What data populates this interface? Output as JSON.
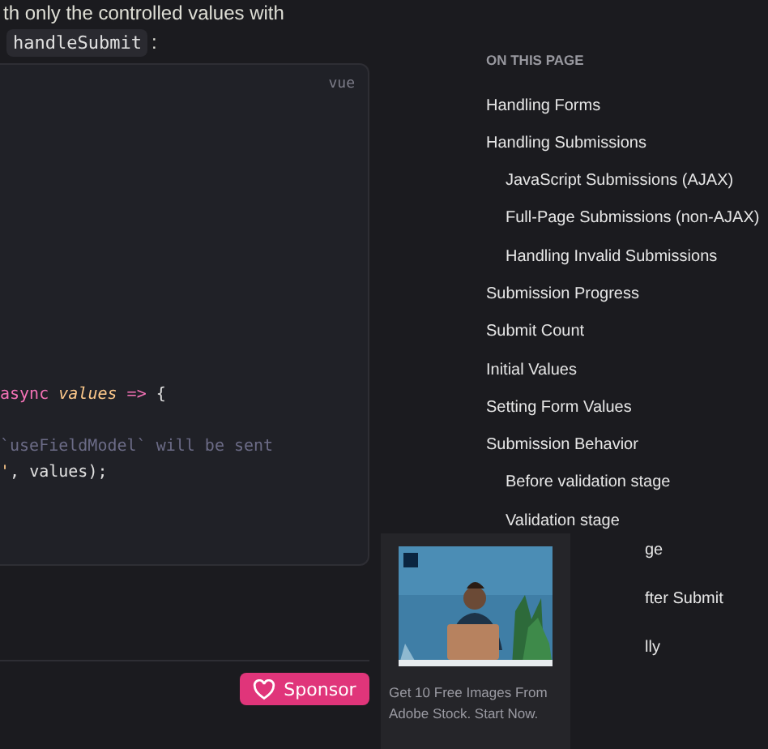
{
  "intro": {
    "text": "th only the controlled values with",
    "code": "handleSubmit",
    "after": ":"
  },
  "code_block": {
    "lang": "vue",
    "lines": [
      {
        "kind": "async",
        "keyword": "async",
        "param": "values",
        "arrow": "=>",
        "brace": "{"
      },
      {
        "kind": "blank"
      },
      {
        "kind": "comment",
        "text": "`useFieldModel` will be sent"
      },
      {
        "kind": "plain",
        "quote": "'",
        "text": ", values);"
      }
    ]
  },
  "sponsor_button": {
    "label": "Sponsor"
  },
  "toc": {
    "heading": "ON THIS PAGE",
    "items": [
      {
        "label": "Handling Forms"
      },
      {
        "label": "Handling Submissions",
        "children": [
          {
            "label": "JavaScript Submissions (AJAX)"
          },
          {
            "label": "Full-Page Submissions (non-AJAX)"
          },
          {
            "label": "Handling Invalid Submissions"
          }
        ]
      },
      {
        "label": "Submission Progress"
      },
      {
        "label": "Submit Count"
      },
      {
        "label": "Initial Values"
      },
      {
        "label": "Setting Form Values"
      },
      {
        "label": "Submission Behavior",
        "children": [
          {
            "label": "Before validation stage"
          },
          {
            "label": "Validation stage"
          }
        ]
      }
    ],
    "partly_hidden": [
      {
        "label": "ge"
      },
      {
        "label": "fter Submit"
      },
      {
        "label": "lly"
      }
    ]
  },
  "ad": {
    "kind": "picture",
    "text": "Get 10 Free Images From Adobe Stock. Start Now."
  }
}
